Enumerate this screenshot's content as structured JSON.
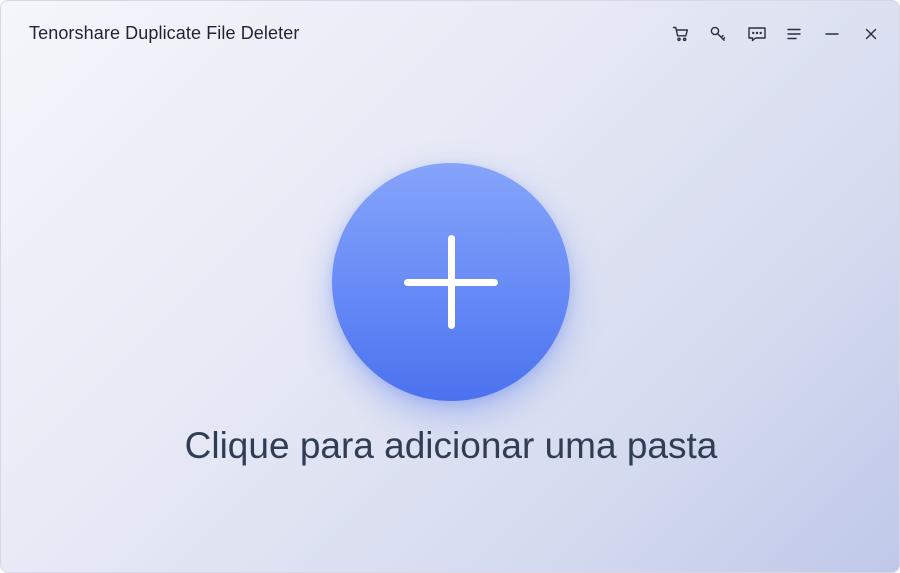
{
  "window": {
    "title": "Tenorshare Duplicate File Deleter"
  },
  "titlebar": {
    "buttons": [
      {
        "icon": "cart-icon"
      },
      {
        "icon": "key-icon"
      },
      {
        "icon": "feedback-icon"
      },
      {
        "icon": "menu-icon"
      },
      {
        "icon": "minimize-icon"
      },
      {
        "icon": "close-icon"
      }
    ]
  },
  "main": {
    "add_folder_label": "Clique para adicionar uma pasta"
  },
  "colors": {
    "accent": "#5b80f3",
    "title_text": "#1f2433",
    "label_text": "#2f3d55"
  }
}
